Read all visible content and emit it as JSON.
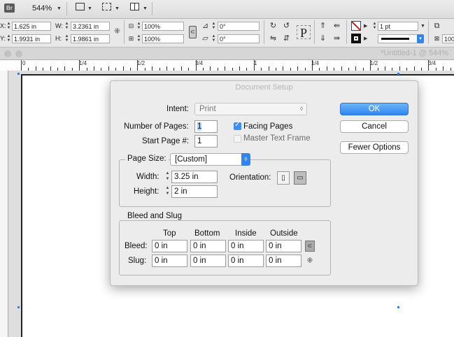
{
  "appbar": {
    "br_label": "Br",
    "zoom": "544%"
  },
  "control": {
    "x_label": "X:",
    "x_value": "1.625 in",
    "y_label": "Y:",
    "y_value": "1.9931 in",
    "w_label": "W:",
    "w_value": "3.2361 in",
    "h_label": "H:",
    "h_value": "1.9861 in",
    "scale_x": "100%",
    "scale_y": "100%",
    "rotate": "0°",
    "shear": "0°",
    "stroke_weight": "1 pt",
    "zoom_short": "100"
  },
  "tab": {
    "title": "*Untitled-1 @ 544%"
  },
  "ruler": {
    "labels": [
      "0",
      "1/4",
      "1/2",
      "3/4",
      "1",
      "1/4",
      "1/2",
      "3/4"
    ]
  },
  "dialog": {
    "title": "Document Setup",
    "intent_label": "Intent:",
    "intent_value": "Print",
    "num_pages_label": "Number of Pages:",
    "num_pages_value": "1",
    "start_page_label": "Start Page #:",
    "start_page_value": "1",
    "facing_pages_label": "Facing Pages",
    "facing_pages_checked": true,
    "master_text_label": "Master Text Frame",
    "master_text_checked": false,
    "ok_label": "OK",
    "cancel_label": "Cancel",
    "fewer_options_label": "Fewer Options",
    "page_size_label": "Page Size:",
    "page_size_value": "[Custom]",
    "width_label": "Width:",
    "width_value": "3.25 in",
    "height_label": "Height:",
    "height_value": "2 in",
    "orientation_label": "Orientation:",
    "bleed_slug_title": "Bleed and Slug",
    "col_top": "Top",
    "col_bottom": "Bottom",
    "col_inside": "Inside",
    "col_outside": "Outside",
    "bleed_label": "Bleed:",
    "slug_label": "Slug:",
    "bleed": [
      "0 in",
      "0 in",
      "0 in",
      "0 in"
    ],
    "slug": [
      "0 in",
      "0 in",
      "0 in",
      "0 in"
    ]
  },
  "colors": {
    "accent": "#2f86f0",
    "page_border": "#222222",
    "selection_handle": "#3b7dd8"
  }
}
